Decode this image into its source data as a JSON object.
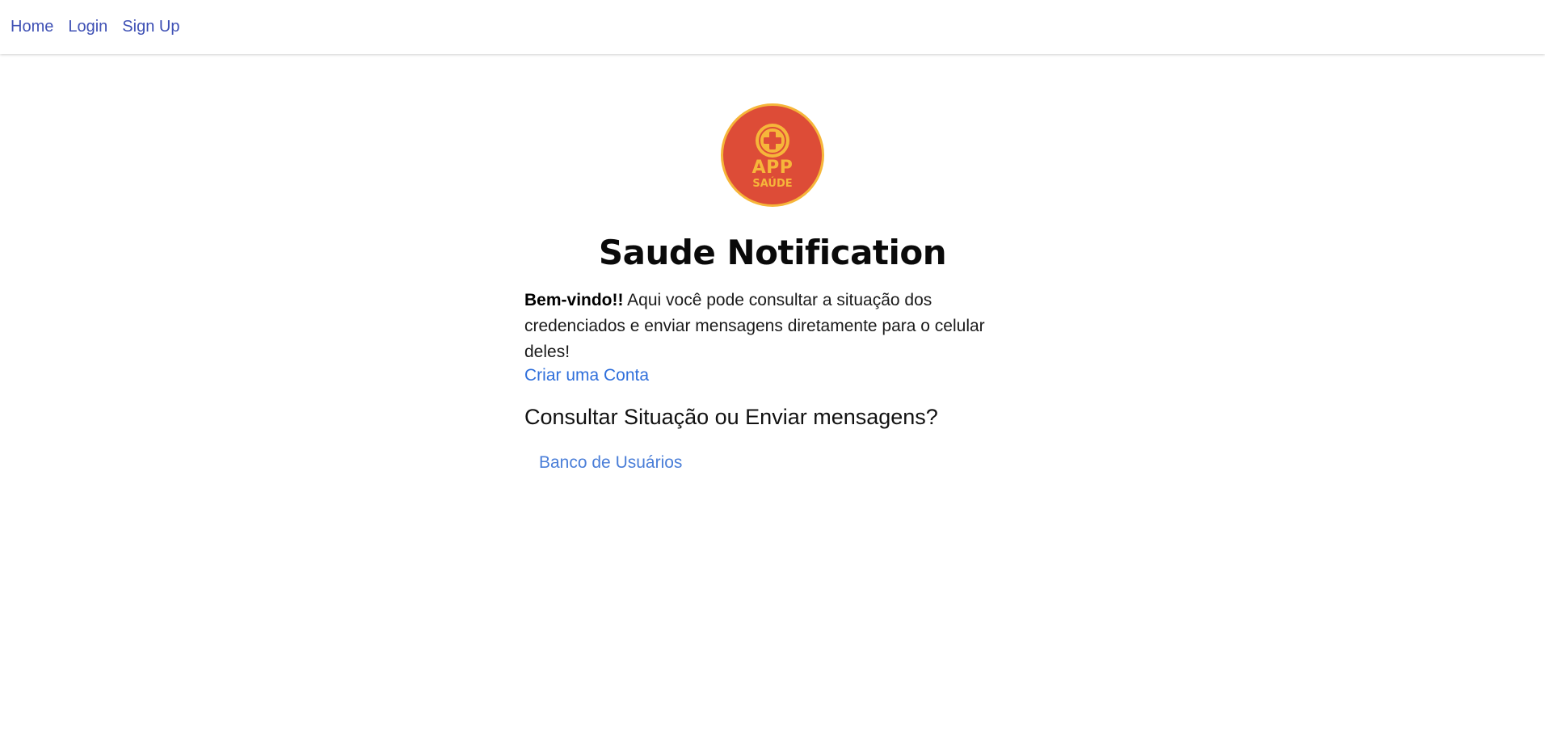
{
  "nav": {
    "items": [
      {
        "label": "Home"
      },
      {
        "label": "Login"
      },
      {
        "label": "Sign Up"
      }
    ]
  },
  "logo": {
    "line1": "APP",
    "line2": "SAÚDE",
    "icon": "medical-cross-icon",
    "colors": {
      "outer": "#f6b63a",
      "inner": "#dd4c37",
      "cross": "#dd4c37"
    }
  },
  "main": {
    "title": "Saude Notification",
    "welcome_bold": "Bem-vindo!!",
    "welcome_text": " Aqui você pode consultar a situação dos credenciados e enviar mensagens diretamente para o celular deles!",
    "create_account": "Criar uma Conta",
    "question": "Consultar Situação ou Enviar mensagens?",
    "users_db": "Banco de Usuários"
  },
  "colors": {
    "nav_link": "#3f51b5",
    "link": "#2f6fdb"
  }
}
